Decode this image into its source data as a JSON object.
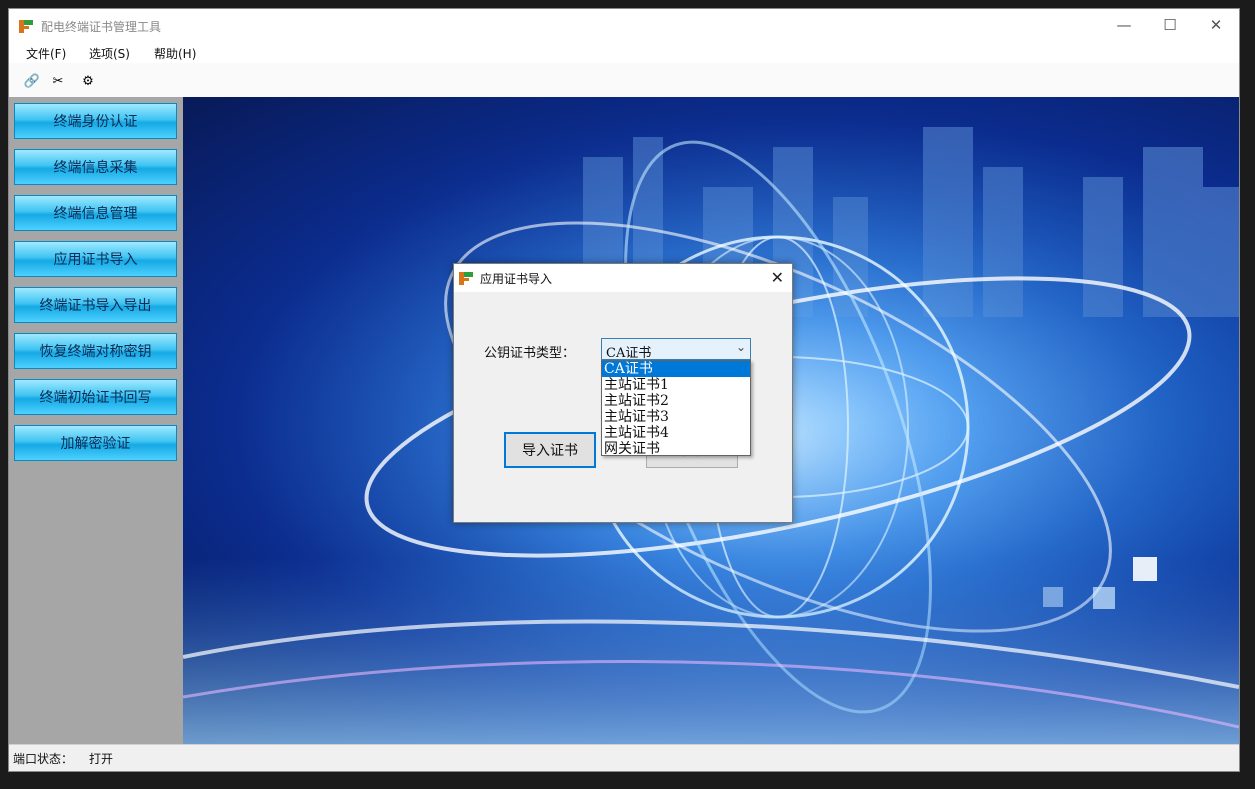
{
  "window": {
    "title": "配电终端证书管理工具",
    "minimize": "—",
    "maximize": "☐",
    "close": "✕"
  },
  "menu": [
    "文件(F)",
    "选项(S)",
    "帮助(H)"
  ],
  "toolbar": {
    "connect_icon": "🔗",
    "disconnect_icon": "✂",
    "settings_icon": "⚙"
  },
  "sidebar": [
    "终端身份认证",
    "终端信息采集",
    "终端信息管理",
    "应用证书导入",
    "终端证书导入导出",
    "恢复终端对称密钥",
    "终端初始证书回写",
    "加解密验证"
  ],
  "status": {
    "label": "端口状态：",
    "value": "打开"
  },
  "dialog": {
    "title": "应用证书导入",
    "close": "✕",
    "field_label": "公钥证书类型：",
    "combo_value": "CA证书",
    "combo_arrow": "⌄",
    "options": [
      "CA证书",
      "主站证书1",
      "主站证书2",
      "主站证书3",
      "主站证书4",
      "网关证书"
    ],
    "selected_index": 0,
    "import_button": "导入证书",
    "cancel_button": "取消"
  }
}
